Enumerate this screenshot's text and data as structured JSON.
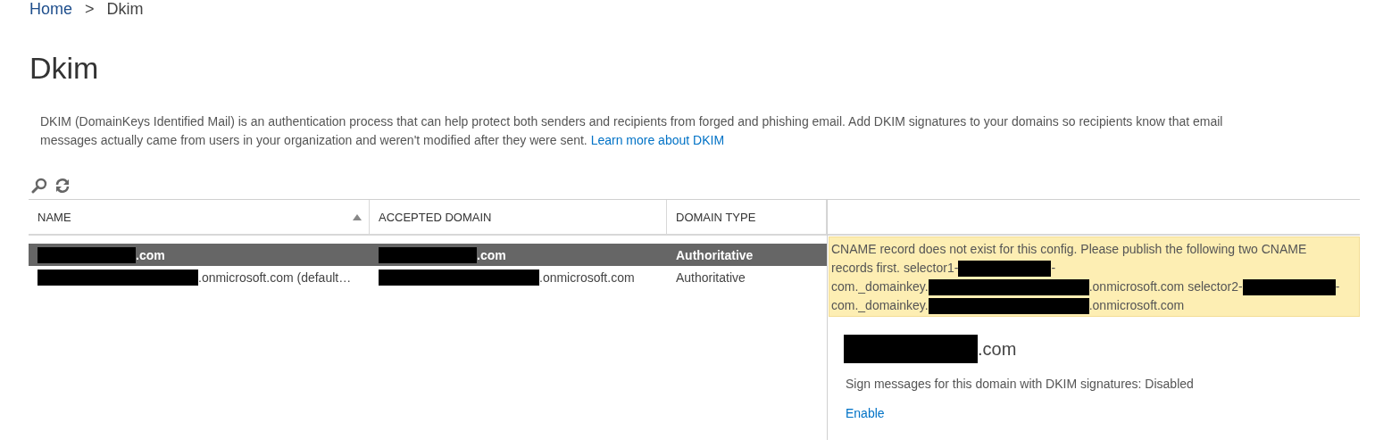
{
  "breadcrumb": [
    {
      "label": "Home",
      "kind": "link"
    },
    {
      "label": ">",
      "kind": "separator"
    },
    {
      "label": "Dkim",
      "kind": "current"
    }
  ],
  "title": "Dkim",
  "description": {
    "text": "DKIM (DomainKeys Identified Mail) is an authentication process that can help protect both senders and recipients from forged and phishing email. Add DKIM signatures to your domains so recipients know that email messages actually came from users in your organization and weren't modified after they were sent.",
    "link": "Learn more about DKIM"
  },
  "toolbar": [
    {
      "kind": "search"
    },
    {
      "kind": "refresh"
    }
  ],
  "table": {
    "columns": [
      {
        "label": "NAME",
        "sorted_ascending": true
      },
      {
        "label": "ACCEPTED DOMAIN",
        "sorted_ascending": false
      },
      {
        "label": "DOMAIN TYPE",
        "sorted_ascending": false
      }
    ],
    "rows": [
      {
        "selected": true,
        "cells": [
          [
            {
              "kind": "redacted"
            },
            {
              "kind": "text",
              "text": ".com"
            }
          ],
          [
            {
              "kind": "redacted"
            },
            {
              "kind": "text",
              "text": ".com"
            }
          ],
          [
            {
              "kind": "text",
              "text": "Authoritative"
            }
          ]
        ]
      },
      {
        "selected": false,
        "cells": [
          [
            {
              "kind": "redacted"
            },
            {
              "kind": "text",
              "text": ".onmicrosoft.com (default…"
            }
          ],
          [
            {
              "kind": "redacted"
            },
            {
              "kind": "text",
              "text": ".onmicrosoft.com"
            }
          ],
          [
            {
              "kind": "text",
              "text": "Authoritative"
            }
          ]
        ]
      }
    ]
  },
  "details": {
    "warning": [
      [
        {
          "kind": "text",
          "text": "CNAME record does not exist for this config. Please publish the following two CNAME"
        }
      ],
      [
        {
          "kind": "text",
          "text": "records first. selector1-"
        },
        {
          "kind": "redacted"
        },
        {
          "kind": "text",
          "text": "-"
        }
      ],
      [
        {
          "kind": "text",
          "text": "com._domainkey."
        },
        {
          "kind": "redacted"
        },
        {
          "kind": "text",
          "text": ".onmicrosoft.com selector2-"
        },
        {
          "kind": "redacted"
        },
        {
          "kind": "text",
          "text": "-"
        }
      ],
      [
        {
          "kind": "text",
          "text": "com._domainkey."
        },
        {
          "kind": "redacted"
        },
        {
          "kind": "text",
          "text": ".onmicrosoft.com"
        }
      ]
    ],
    "domain": [
      {
        "kind": "redacted"
      },
      {
        "kind": "text",
        "text": ".com"
      }
    ],
    "status": "Sign messages for this domain with DKIM signatures: Disabled",
    "action": "Enable"
  }
}
